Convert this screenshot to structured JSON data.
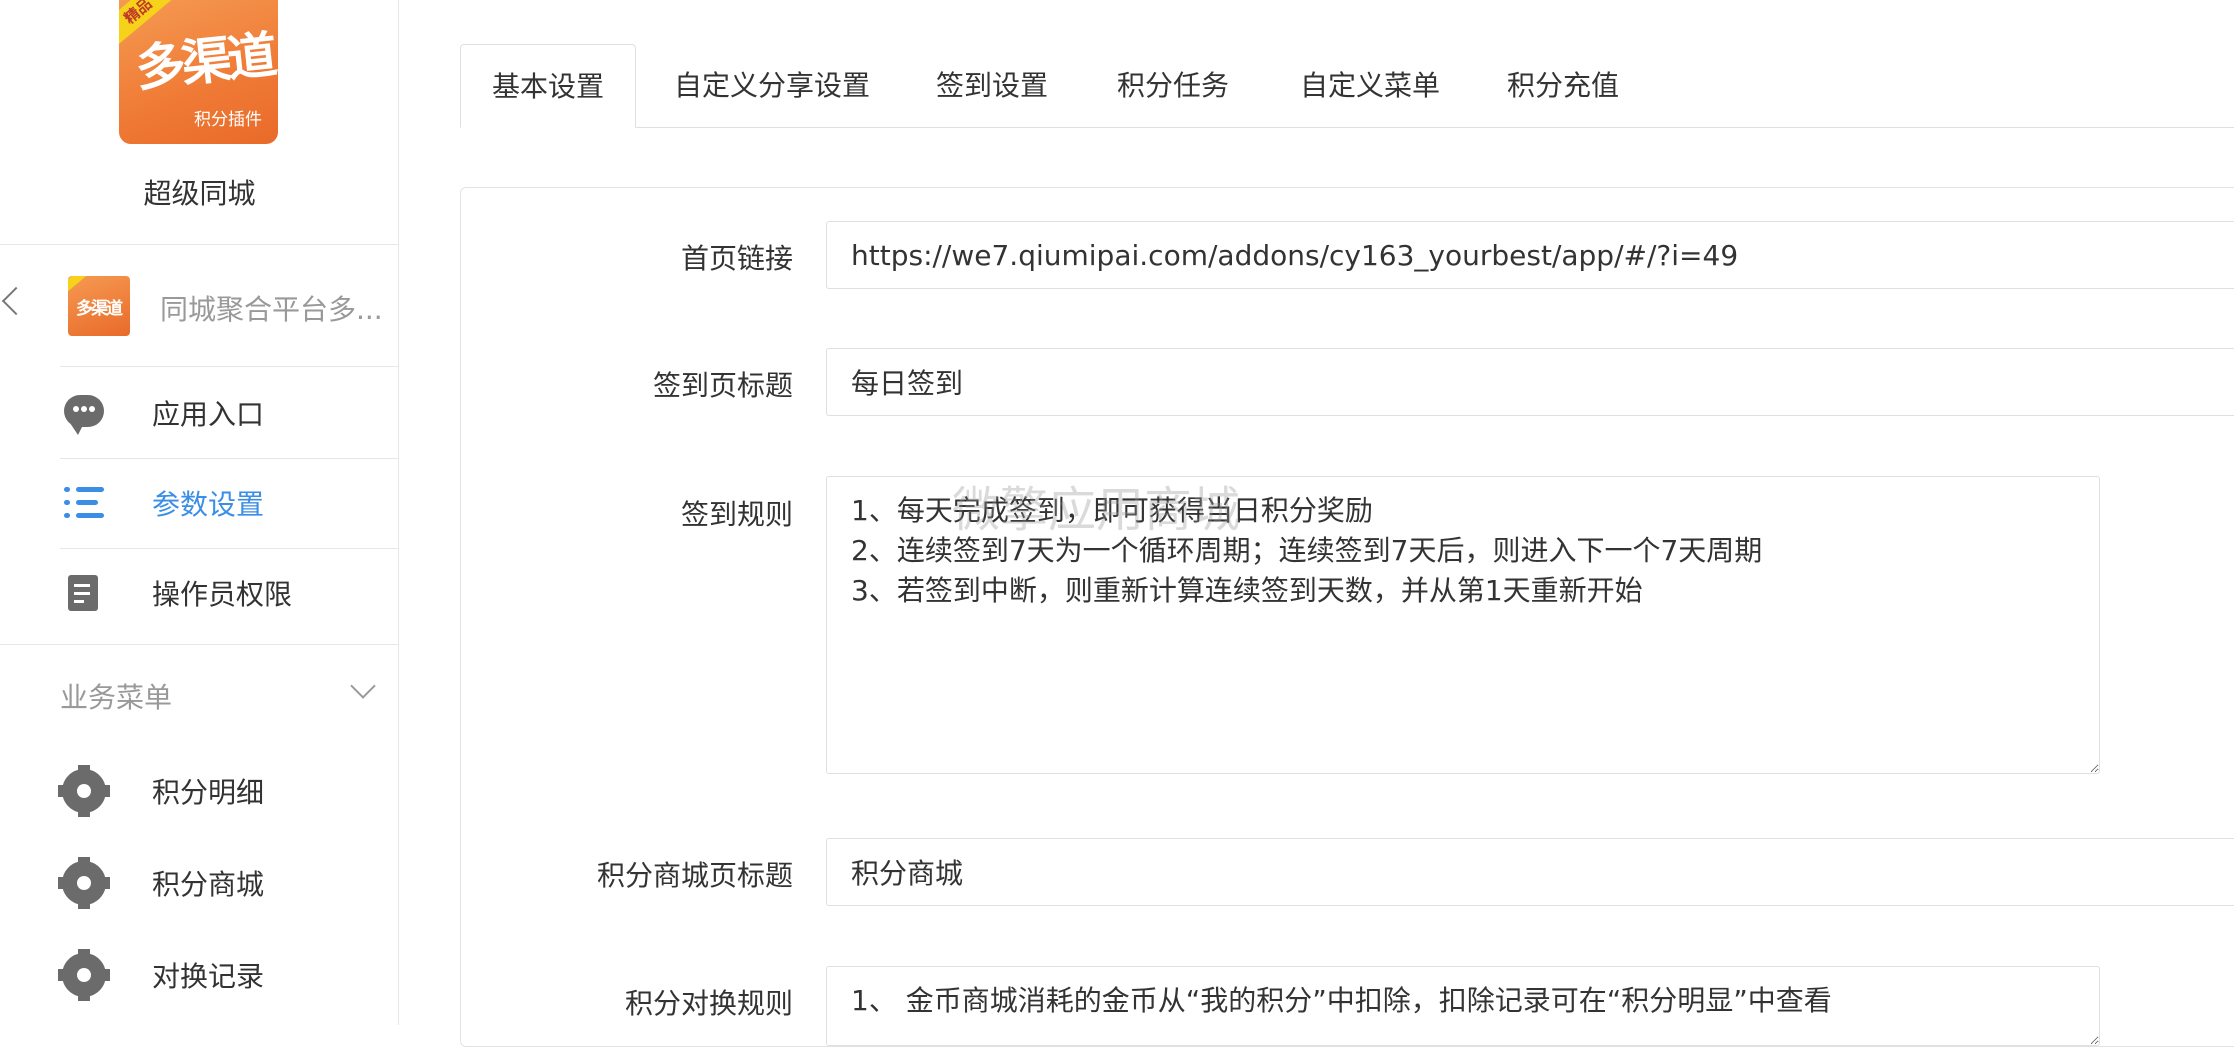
{
  "sidebar": {
    "logo": {
      "ribbon": "精品",
      "big": "多渠道",
      "small": "积分插件"
    },
    "app_name": "超级同城",
    "plugin_name": "同城聚合平台多...",
    "nav_items": [
      {
        "label": "应用入口",
        "icon": "chat-bubble-icon",
        "active": false
      },
      {
        "label": "参数设置",
        "icon": "list-settings-icon",
        "active": true
      },
      {
        "label": "操作员权限",
        "icon": "edit-document-icon",
        "active": false
      }
    ],
    "section_title": "业务菜单",
    "section_items": [
      {
        "label": "积分明细",
        "icon": "gear-icon"
      },
      {
        "label": "积分商城",
        "icon": "gear-icon"
      },
      {
        "label": "对换记录",
        "icon": "gear-icon"
      }
    ],
    "accent_color": "#3a8ee6"
  },
  "tabs": [
    {
      "label": "基本设置",
      "active": true
    },
    {
      "label": "自定义分享设置",
      "active": false
    },
    {
      "label": "签到设置",
      "active": false
    },
    {
      "label": "积分任务",
      "active": false
    },
    {
      "label": "自定义菜单",
      "active": false
    },
    {
      "label": "积分充值",
      "active": false
    }
  ],
  "form": {
    "home_link": {
      "label": "首页链接",
      "value": "https://we7.qiumipai.com/addons/cy163_yourbest/app/#/?i=49"
    },
    "signin_title": {
      "label": "签到页标题",
      "value": "每日签到"
    },
    "signin_rules": {
      "label": "签到规则",
      "value": "1、每天完成签到，即可获得当日积分奖励\n2、连续签到7天为一个循环周期；连续签到7天后，则进入下一个7天周期\n3、若签到中断，则重新计算连续签到天数，并从第1天重新开始"
    },
    "mall_title": {
      "label": "积分商城页标题",
      "value": "积分商城"
    },
    "exchange_rules": {
      "label": "积分对换规则",
      "value": "1、 金币商城消耗的金币从“我的积分”中扣除，扣除记录可在“积分明显”中查看"
    }
  },
  "watermark": "微擎应用商城"
}
